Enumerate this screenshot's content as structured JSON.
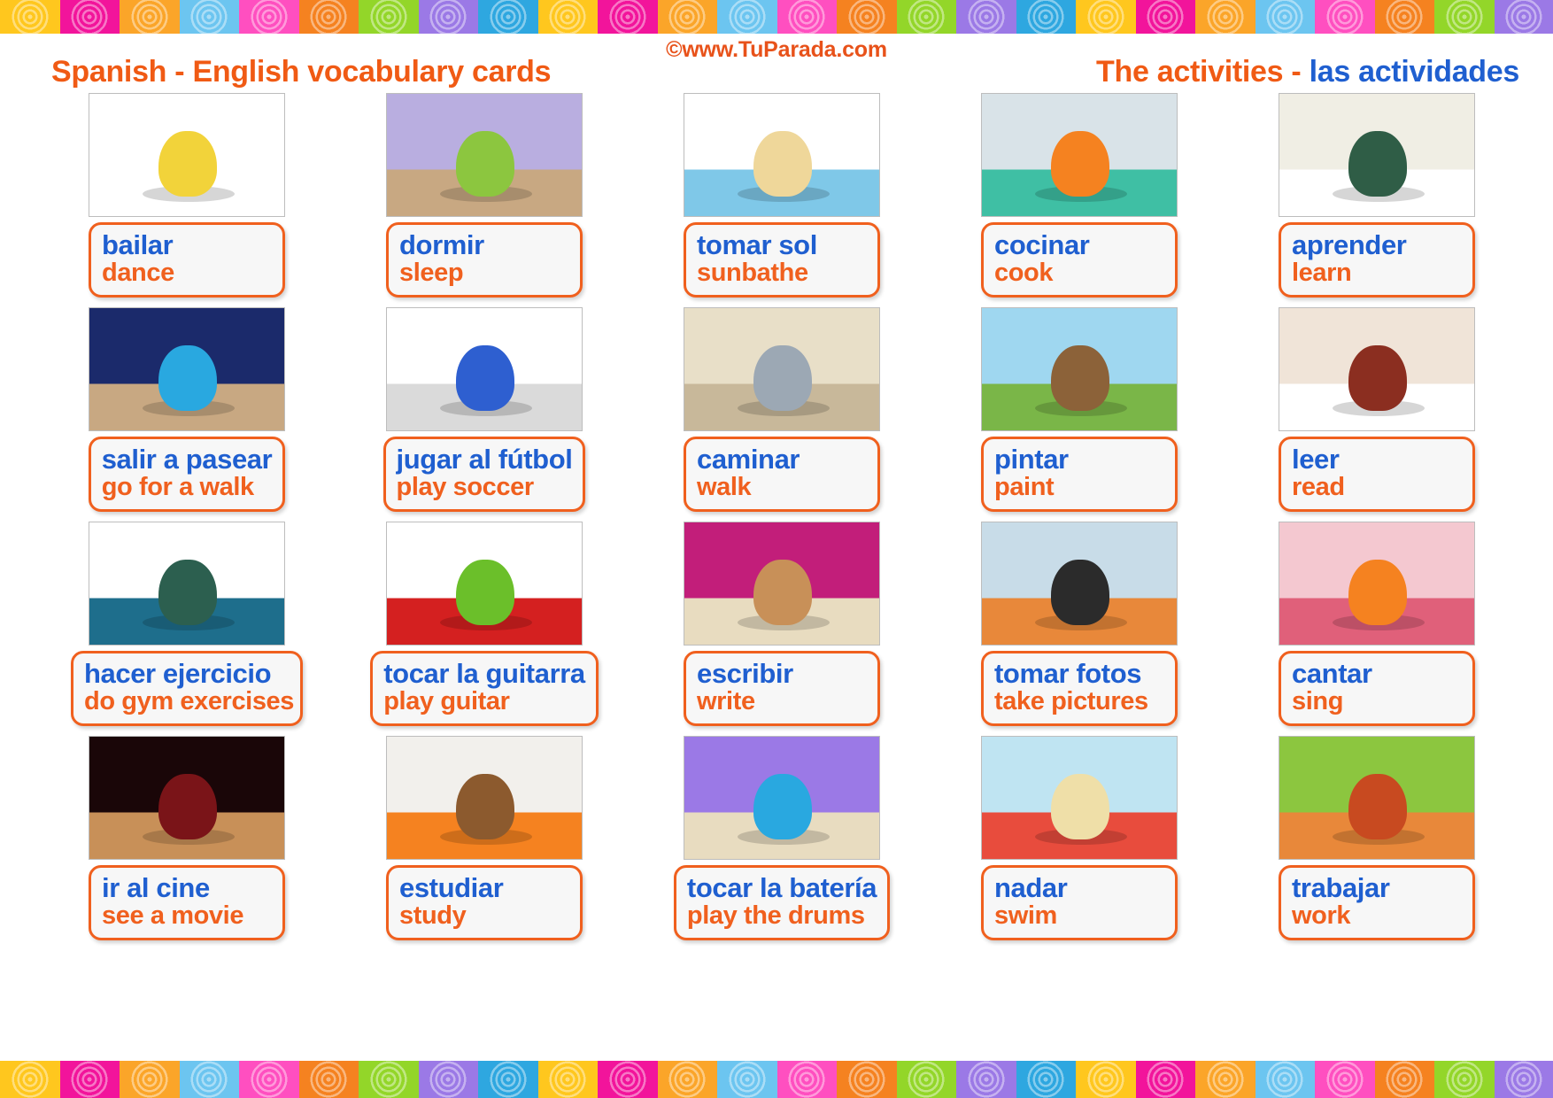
{
  "header": {
    "copyright": "©www.TuParada.com",
    "title_left": "Spanish - English vocabulary cards",
    "title_right_en": "The activities - ",
    "title_right_es": "las actividades"
  },
  "colors": {
    "spanish_text": "#1F5FD0",
    "english_text": "#F0601E",
    "card_border": "#F0601E",
    "card_background": "#F7F7F7",
    "title_orange": "#F05A14"
  },
  "strip_colors": [
    "#FFC71E",
    "#F2149B",
    "#FBA529",
    "#6CC5F0",
    "#FF4FC0",
    "#F58220",
    "#93D629",
    "#9B79E6",
    "#2EA7E0"
  ],
  "cards": [
    {
      "es": "bailar",
      "en": "dance",
      "image": "dancing-monster-with-music-notes"
    },
    {
      "es": "dormir",
      "en": "sleep",
      "image": "child-sleeping-in-bedroom"
    },
    {
      "es": "tomar sol",
      "en": "sunbathe",
      "image": "bear-sunbathing-on-beach"
    },
    {
      "es": "cocinar",
      "en": "cook",
      "image": "monster-cooking-in-kitchen"
    },
    {
      "es": "aprender",
      "en": "learn",
      "image": "teacher-at-blackboard-with-student"
    },
    {
      "es": "salir a pasear",
      "en": "go for a walk",
      "image": "blue-monster-walking-at-night"
    },
    {
      "es": "jugar al fútbol",
      "en": "play soccer",
      "image": "monster-goalkeeper-with-soccer-ball"
    },
    {
      "es": "caminar",
      "en": "walk",
      "image": "child-walking-in-city"
    },
    {
      "es": "pintar",
      "en": "paint",
      "image": "bear-painting-tree-in-park"
    },
    {
      "es": "leer",
      "en": "read",
      "image": "ghost-reading-book-on-bed"
    },
    {
      "es": "hacer ejercicio",
      "en": "do gym exercises",
      "image": "child-exercising-on-gym-machine"
    },
    {
      "es": "tocar la guitarra",
      "en": "play guitar",
      "image": "green-monster-playing-electric-guitar"
    },
    {
      "es": "escribir",
      "en": "write",
      "image": "bear-writing-at-desk-in-library"
    },
    {
      "es": "tomar fotos",
      "en": "take pictures",
      "image": "child-with-camera-and-photos"
    },
    {
      "es": "cantar",
      "en": "sing",
      "image": "orange-monster-singing-on-stage"
    },
    {
      "es": "ir al cine",
      "en": "see a movie",
      "image": "two-children-in-movie-theater"
    },
    {
      "es": "estudiar",
      "en": "study",
      "image": "monster-studying-at-desk-with-laptop"
    },
    {
      "es": "tocar la batería",
      "en": "play the drums",
      "image": "blue-monster-playing-drum-kit"
    },
    {
      "es": "nadar",
      "en": "swim",
      "image": "child-with-float-ring-at-beach"
    },
    {
      "es": "trabajar",
      "en": "work",
      "image": "orange-monster-working-in-office"
    }
  ]
}
